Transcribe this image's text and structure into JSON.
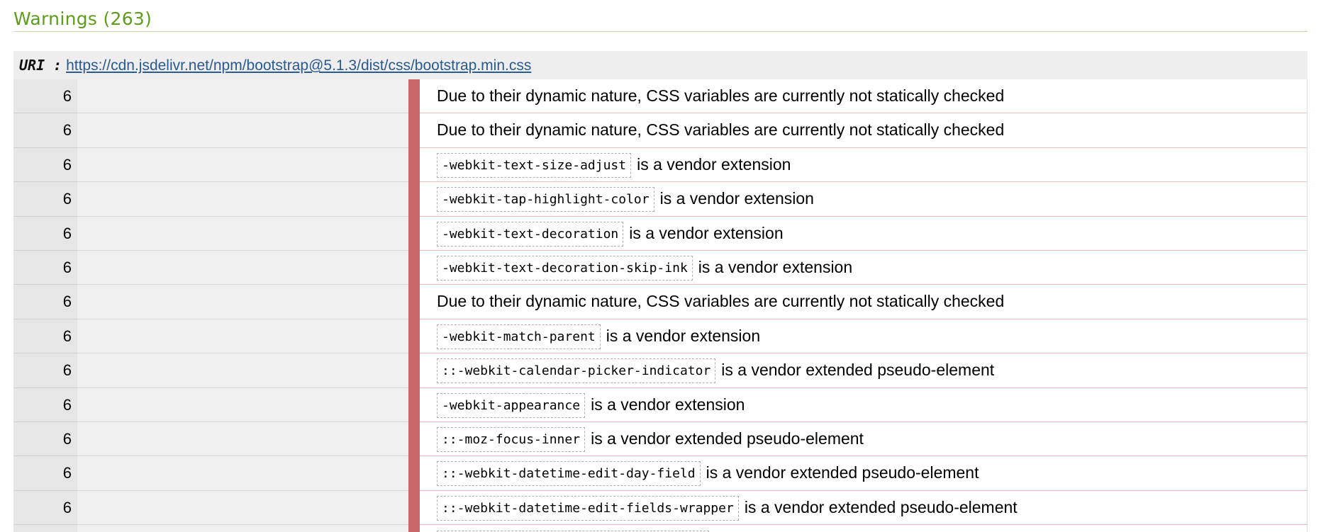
{
  "heading": "Warnings (263)",
  "uri": {
    "label": "URI :",
    "link": "https://cdn.jsdelivr.net/npm/bootstrap@5.1.3/dist/css/bootstrap.min.css"
  },
  "colors": {
    "heading": "#5e9c1c",
    "bar": "#c8676a",
    "link": "#2a5a8e"
  },
  "rows": [
    {
      "line": "6",
      "code": "",
      "message": "Due to their dynamic nature, CSS variables are currently not statically checked"
    },
    {
      "line": "6",
      "code": "",
      "message": "Due to their dynamic nature, CSS variables are currently not statically checked"
    },
    {
      "line": "6",
      "code": "-webkit-text-size-adjust",
      "message": "is a vendor extension"
    },
    {
      "line": "6",
      "code": "-webkit-tap-highlight-color",
      "message": "is a vendor extension"
    },
    {
      "line": "6",
      "code": "-webkit-text-decoration",
      "message": "is a vendor extension"
    },
    {
      "line": "6",
      "code": "-webkit-text-decoration-skip-ink",
      "message": "is a vendor extension"
    },
    {
      "line": "6",
      "code": "",
      "message": "Due to their dynamic nature, CSS variables are currently not statically checked"
    },
    {
      "line": "6",
      "code": "-webkit-match-parent",
      "message": "is a vendor extension"
    },
    {
      "line": "6",
      "code": "::-webkit-calendar-picker-indicator",
      "message": "is a vendor extended pseudo-element"
    },
    {
      "line": "6",
      "code": "-webkit-appearance",
      "message": "is a vendor extension"
    },
    {
      "line": "6",
      "code": "::-moz-focus-inner",
      "message": "is a vendor extended pseudo-element"
    },
    {
      "line": "6",
      "code": "::-webkit-datetime-edit-day-field",
      "message": "is a vendor extended pseudo-element"
    },
    {
      "line": "6",
      "code": "::-webkit-datetime-edit-fields-wrapper",
      "message": "is a vendor extended pseudo-element"
    }
  ]
}
